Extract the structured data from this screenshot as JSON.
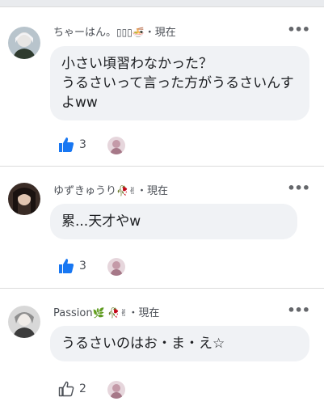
{
  "comments": [
    {
      "name": "ちゃーはん。",
      "emojis": "▯▯▯🍜",
      "time": "・現在",
      "text": "小さい頃習わなかった？\nうるさいって言った方がうるさいんすよww",
      "likes": "3",
      "liked": true
    },
    {
      "name": "ゆずきゅうり",
      "emojis": "🥀✌",
      "time": "・現在",
      "text": "累...天才やw",
      "likes": "3",
      "liked": true
    },
    {
      "name": "Passion",
      "emojis": "🌿 🥀✌",
      "time": "・現在",
      "text": "うるさいのはお・ま・え☆",
      "likes": "2",
      "liked": false
    }
  ],
  "more_label": "•••",
  "colors": {
    "like_active": "#1877f2",
    "like_inactive": "#4b4f56",
    "bubble": "#f0f2f5"
  }
}
